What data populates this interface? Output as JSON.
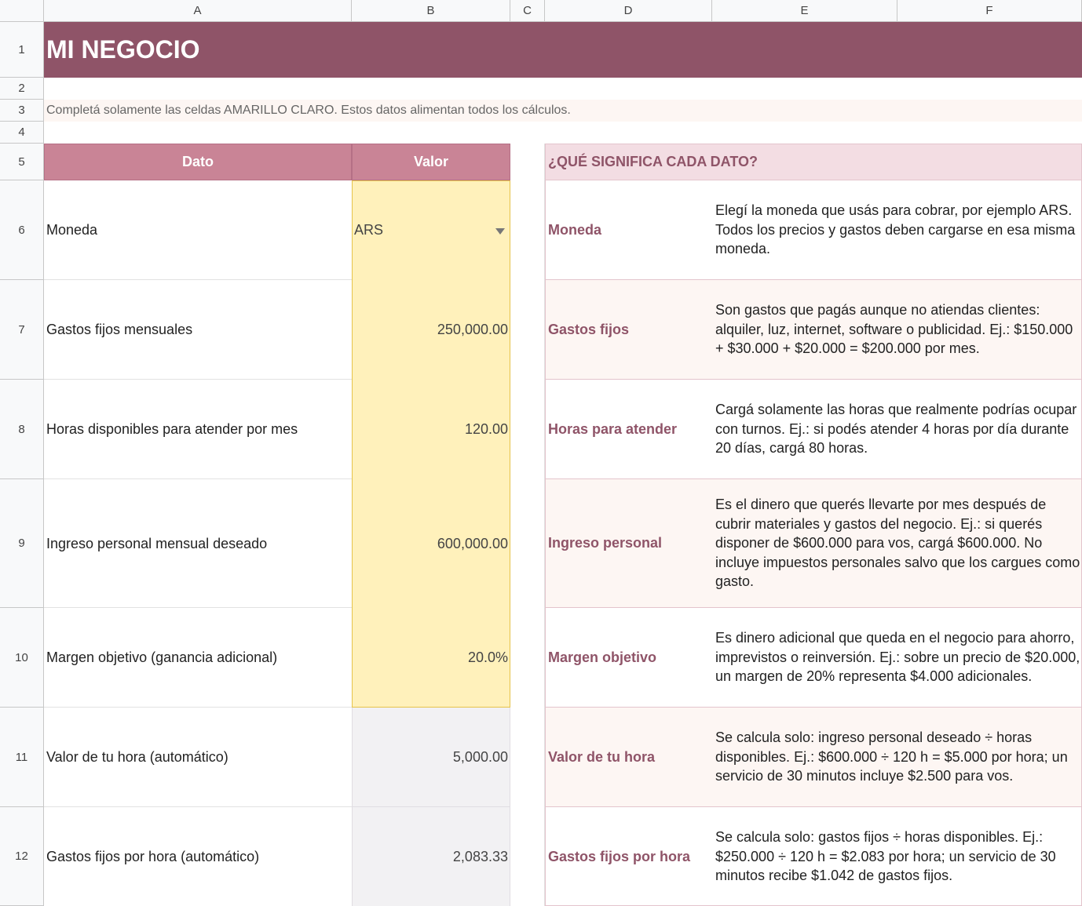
{
  "columns": [
    "A",
    "B",
    "C",
    "D",
    "E",
    "F"
  ],
  "rows": [
    "1",
    "2",
    "3",
    "4",
    "5",
    "6",
    "7",
    "8",
    "9",
    "10",
    "11",
    "12"
  ],
  "title": "MI NEGOCIO",
  "note": "Completá solamente las celdas AMARILLO CLARO. Estos datos alimentan todos los cálculos.",
  "table": {
    "header_dato": "Dato",
    "header_valor": "Valor",
    "rows": [
      {
        "label": "Moneda",
        "value": "ARS"
      },
      {
        "label": "Gastos fijos mensuales",
        "value": "250,000.00"
      },
      {
        "label": "Horas disponibles para atender por mes",
        "value": "120.00"
      },
      {
        "label": "Ingreso personal mensual deseado",
        "value": "600,000.00"
      },
      {
        "label": "Margen objetivo (ganancia adicional)",
        "value": "20.0%"
      },
      {
        "label": "Valor de tu hora (automático)",
        "value": "5,000.00"
      },
      {
        "label": "Gastos fijos por hora (automático)",
        "value": "2,083.33"
      }
    ]
  },
  "help": {
    "title": "¿QUÉ SIGNIFICA CADA DATO?",
    "items": [
      {
        "term": "Moneda",
        "desc": "Elegí la moneda que usás para cobrar, por ejemplo ARS. Todos los precios y gastos deben cargarse en esa misma moneda."
      },
      {
        "term": "Gastos fijos",
        "desc": "Son gastos que pagás aunque no atiendas clientes: alquiler, luz, internet, software o publicidad. Ej.: $150.000 + $30.000 + $20.000 = $200.000 por mes."
      },
      {
        "term": "Horas para atender",
        "desc": "Cargá solamente las horas que realmente podrías ocupar con turnos. Ej.: si podés atender 4 horas por día durante 20 días, cargá 80 horas."
      },
      {
        "term": "Ingreso personal",
        "desc": "Es el dinero que querés llevarte por mes después de cubrir materiales y gastos del negocio. Ej.: si querés disponer de $600.000 para vos, cargá $600.000. No incluye impuestos personales salvo que los cargues como gasto."
      },
      {
        "term": "Margen objetivo",
        "desc": "Es dinero adicional que queda en el negocio para ahorro, imprevistos o reinversión. Ej.: sobre un precio de $20.000, un margen de 20% representa $4.000 adicionales."
      },
      {
        "term": "Valor de tu hora",
        "desc": "Se calcula solo: ingreso personal deseado ÷ horas disponibles. Ej.: $600.000 ÷ 120 h = $5.000 por hora; un servicio de 30 minutos incluye $2.500 para vos."
      },
      {
        "term": "Gastos fijos por hora",
        "desc": "Se calcula solo: gastos fijos ÷ horas disponibles. Ej.: $250.000 ÷ 120 h = $2.083 por hora; un servicio de 30 minutos recibe $1.042 de gastos fijos."
      }
    ]
  },
  "colors": {
    "title_band": "#8f5468",
    "header_pink": "#c98496",
    "help_header": "#f3dde3",
    "input_yellow": "#fff1bb",
    "auto_gray": "#f2f1f3"
  },
  "icons": {
    "dropdown": "dropdown-arrow-icon"
  }
}
